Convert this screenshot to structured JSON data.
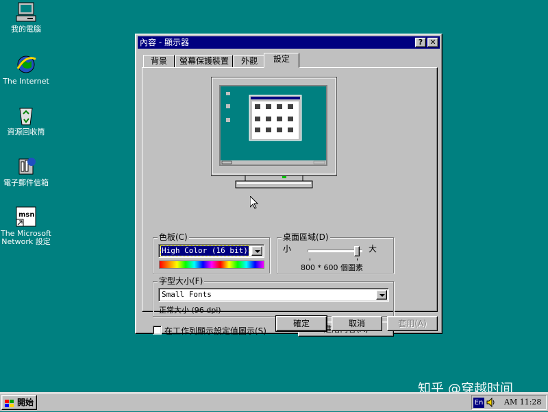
{
  "desktop": {
    "icons": [
      {
        "label": "我的電腦",
        "icon": "my-computer-icon"
      },
      {
        "label": "The Internet",
        "icon": "internet-explorer-icon"
      },
      {
        "label": "資源回收筒",
        "icon": "recycle-bin-icon"
      },
      {
        "label": "電子郵件信箱",
        "icon": "inbox-icon"
      },
      {
        "label": "The Microsoft Network 設定",
        "icon": "msn-icon"
      }
    ],
    "msn_logo_text": "msn",
    "watermark": "知乎 @穿越时间"
  },
  "window": {
    "title": "內容 - 顯示器",
    "help_label": "?",
    "close_label": "✕",
    "tabs": [
      {
        "label": "背景"
      },
      {
        "label": "螢幕保護裝置"
      },
      {
        "label": "外觀"
      },
      {
        "label": "設定",
        "active": true
      }
    ],
    "color_palette": {
      "title": "色板(C)",
      "value": "High Color (16 bit)"
    },
    "desktop_area": {
      "title": "桌面區域(D)",
      "min_label": "小",
      "max_label": "大",
      "resolution": "800 * 600 個圖素",
      "slider_level": 0.95
    },
    "font_size": {
      "title": "字型大小(F)",
      "value": "Small Fonts",
      "description": "正常大小 (96 dpi)"
    },
    "taskbar_checkbox": {
      "label": "在工作列顯示設定值圖示(S)",
      "checked": false
    },
    "advanced_button": "進階內容(A)",
    "ok_button": "確定",
    "cancel_button": "取消",
    "apply_button": "套用(A)"
  },
  "taskbar": {
    "start_label": "開始",
    "lang_indicator": "En",
    "clock": "AM 11:28"
  },
  "colors": {
    "desktop": "#008080",
    "title_bar": "#000080",
    "face": "#c0c0c0",
    "selection": "#000080"
  }
}
